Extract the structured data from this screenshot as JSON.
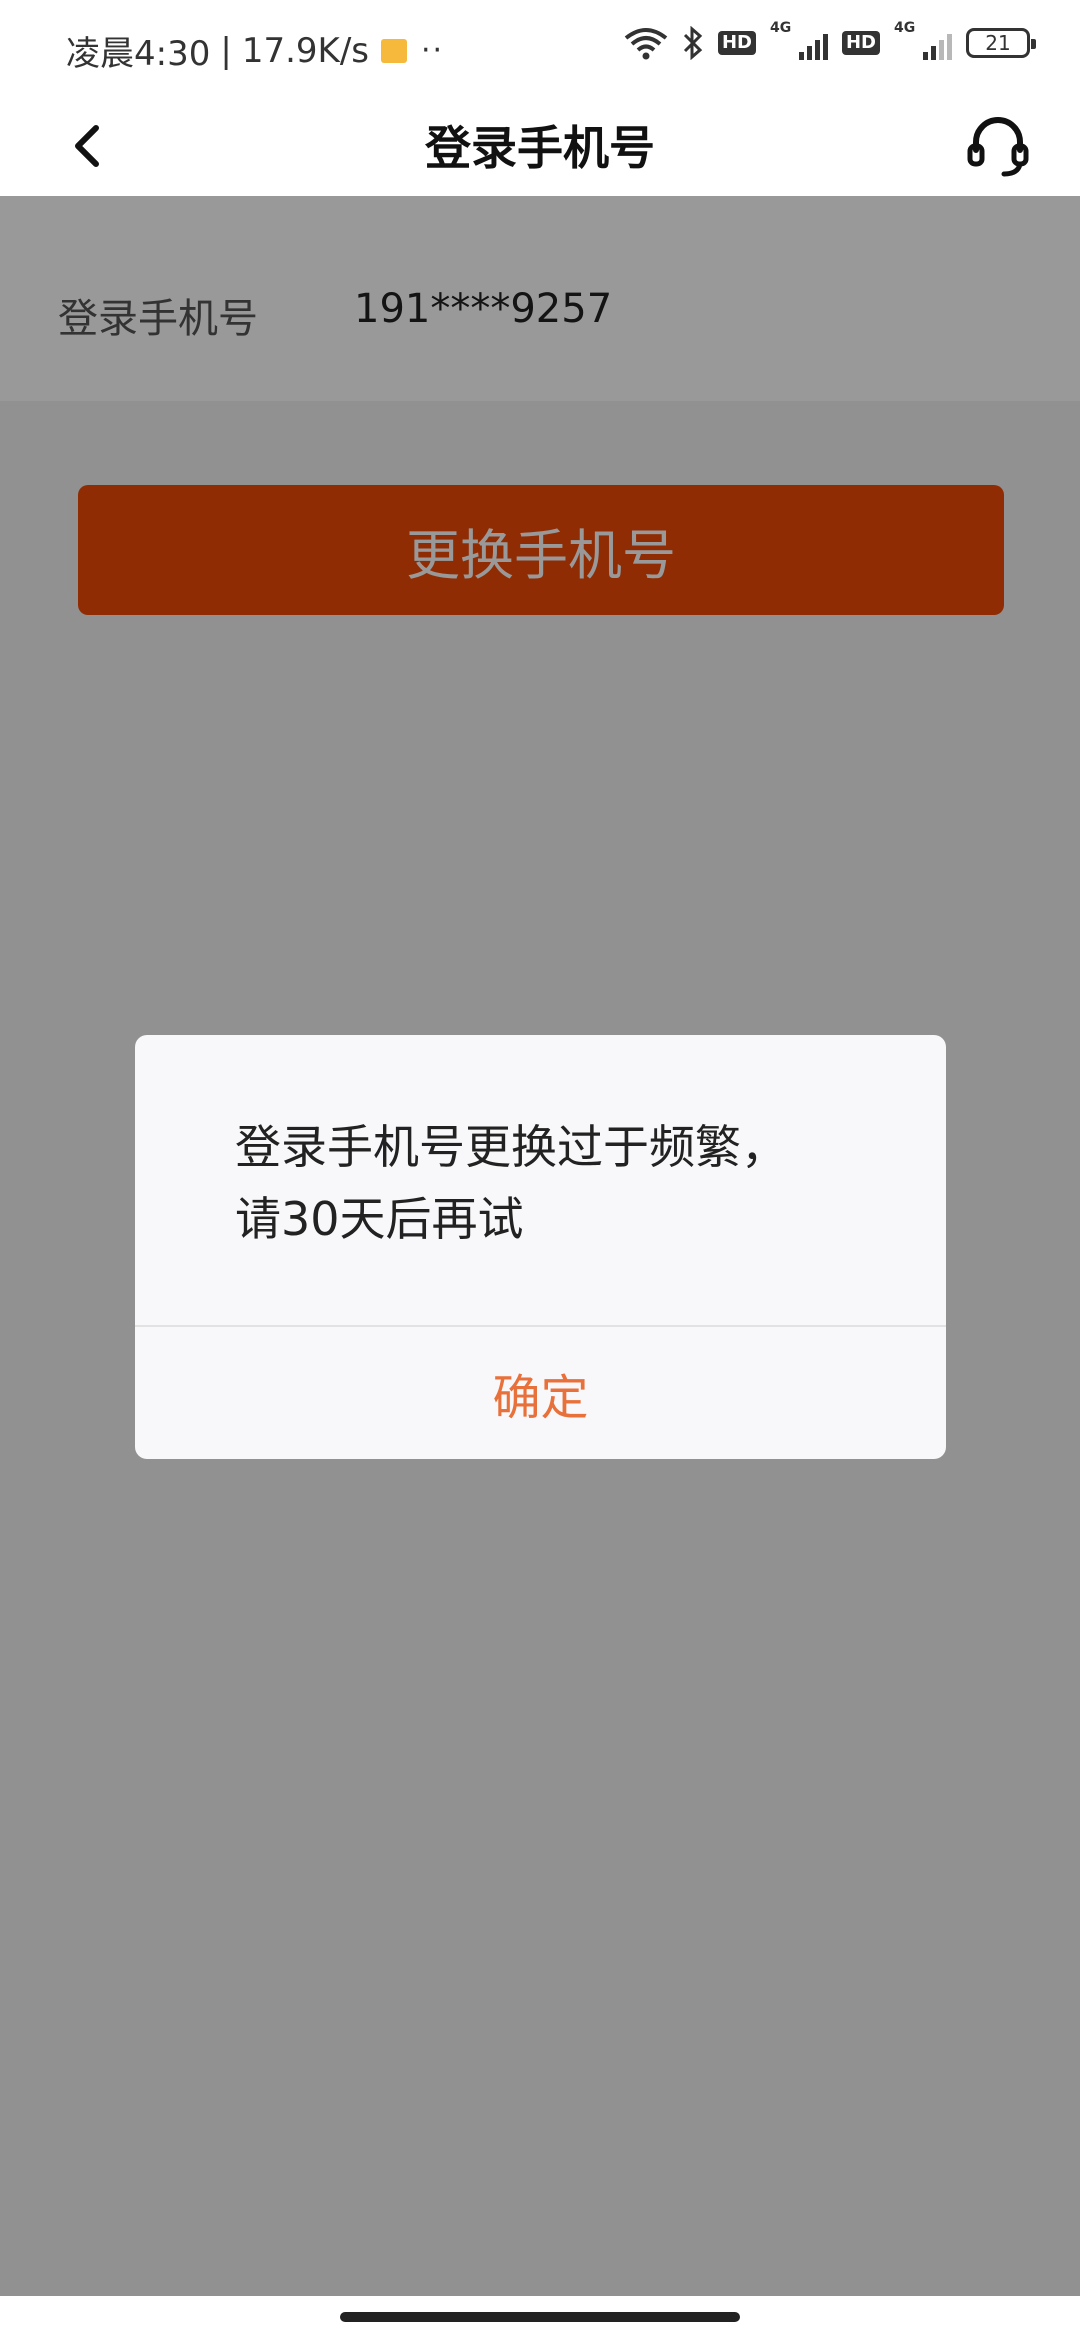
{
  "status_bar": {
    "time": "凌晨4:30",
    "net_speed": "17.9K/s",
    "dots": "··",
    "hd1": "HD",
    "net1": "4G",
    "hd2": "HD",
    "net2": "4G",
    "battery": "21"
  },
  "nav": {
    "title": "登录手机号",
    "back_icon": "chevron-left-icon",
    "support_icon": "headset-icon"
  },
  "account": {
    "label": "登录手机号",
    "phone": "191****9257"
  },
  "change_button": {
    "label": "更换手机号"
  },
  "dialog": {
    "line1": "登录手机号更换过于频繁，",
    "line2": "请30天后再试",
    "ok_label": "确定"
  },
  "colors": {
    "accent": "#f04a06",
    "dialog_ok": "#e8703a",
    "overlay": "rgba(0,0,0,0.40)"
  }
}
